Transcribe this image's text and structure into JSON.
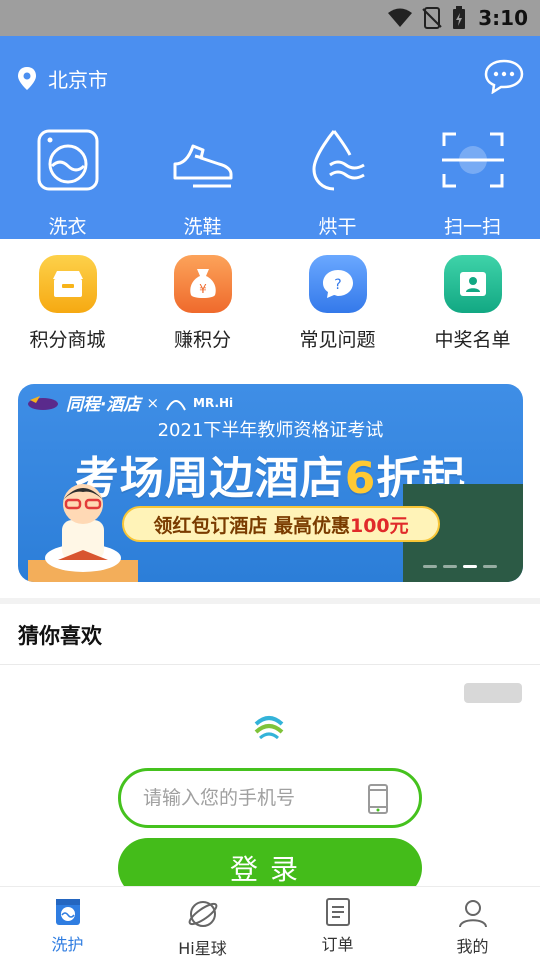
{
  "status_bar": {
    "time": "3:10"
  },
  "header": {
    "location": "北京市",
    "top_services": [
      {
        "label": "洗衣",
        "icon": "washing-machine-icon"
      },
      {
        "label": "洗鞋",
        "icon": "shoe-icon"
      },
      {
        "label": "烘干",
        "icon": "water-drop-icon"
      },
      {
        "label": "扫一扫",
        "icon": "scan-icon"
      }
    ]
  },
  "secondary_services": [
    {
      "label": "积分商城",
      "icon": "shop-icon",
      "color": "#f8b419"
    },
    {
      "label": "赚积分",
      "icon": "money-bag-icon",
      "color": "#f5843a"
    },
    {
      "label": "常见问题",
      "icon": "question-icon",
      "color": "#4a8ff0"
    },
    {
      "label": "中奖名单",
      "icon": "winner-list-icon",
      "color": "#19b995"
    }
  ],
  "banner": {
    "brand": "同程·酒店",
    "partner": "MR.Hi",
    "subtitle": "2021下半年教师资格证考试",
    "headline_pre": "考场周边酒店",
    "headline_hl": "6",
    "headline_post": "折起",
    "pill_pre": "领红包订酒店 最高优惠",
    "pill_red": "100元"
  },
  "guess": {
    "title": "猜你喜欢"
  },
  "login": {
    "phone_placeholder": "请输入您的手机号",
    "button_label": "登录"
  },
  "bottom_nav": [
    {
      "label": "洗护",
      "icon": "laundry-icon",
      "active": true
    },
    {
      "label": "Hi星球",
      "icon": "planet-icon",
      "active": false
    },
    {
      "label": "订单",
      "icon": "order-icon",
      "active": false
    },
    {
      "label": "我的",
      "icon": "profile-icon",
      "active": false
    }
  ],
  "colors": {
    "primary": "#4b8ff0",
    "login_green": "#44bc1a",
    "nav_active": "#2f7de1"
  }
}
